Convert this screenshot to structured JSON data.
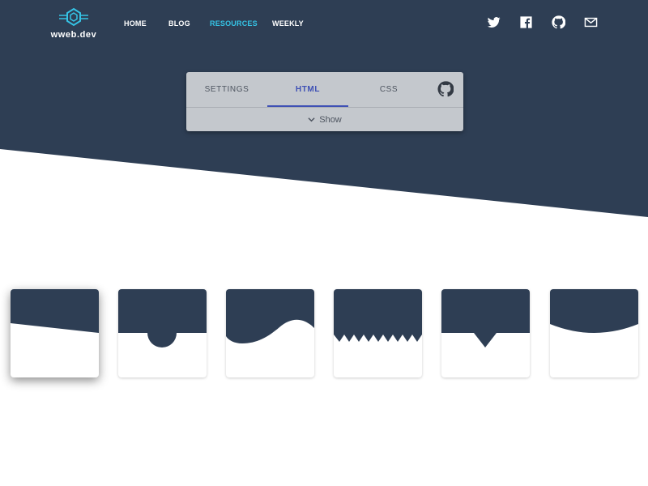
{
  "brand": {
    "name": "wweb.dev"
  },
  "nav": {
    "items": [
      {
        "label": "HOME"
      },
      {
        "label": "BLOG"
      },
      {
        "label": "RESOURCES",
        "active": true
      },
      {
        "label": "WEEKLY"
      }
    ]
  },
  "social": [
    {
      "icon": "twitter-icon"
    },
    {
      "icon": "facebook-icon"
    },
    {
      "icon": "github-icon"
    },
    {
      "icon": "mail-icon"
    }
  ],
  "panel": {
    "tabs": [
      {
        "label": "SETTINGS"
      },
      {
        "label": "HTML",
        "active": true
      },
      {
        "label": "CSS"
      }
    ],
    "github_icon": "github-icon",
    "toggle": {
      "icon": "chevron-down-icon",
      "label": "Show"
    }
  },
  "separators": [
    {
      "style": "slant",
      "selected": true
    },
    {
      "style": "half-circle"
    },
    {
      "style": "wave"
    },
    {
      "style": "zigzag"
    },
    {
      "style": "triangle"
    },
    {
      "style": "curve"
    }
  ],
  "colors": {
    "primary": "#2e3e54",
    "accent": "#35c3e5",
    "panel": "#c4c8cd",
    "tab_active": "#3f51b5",
    "background": "#ffffff"
  }
}
